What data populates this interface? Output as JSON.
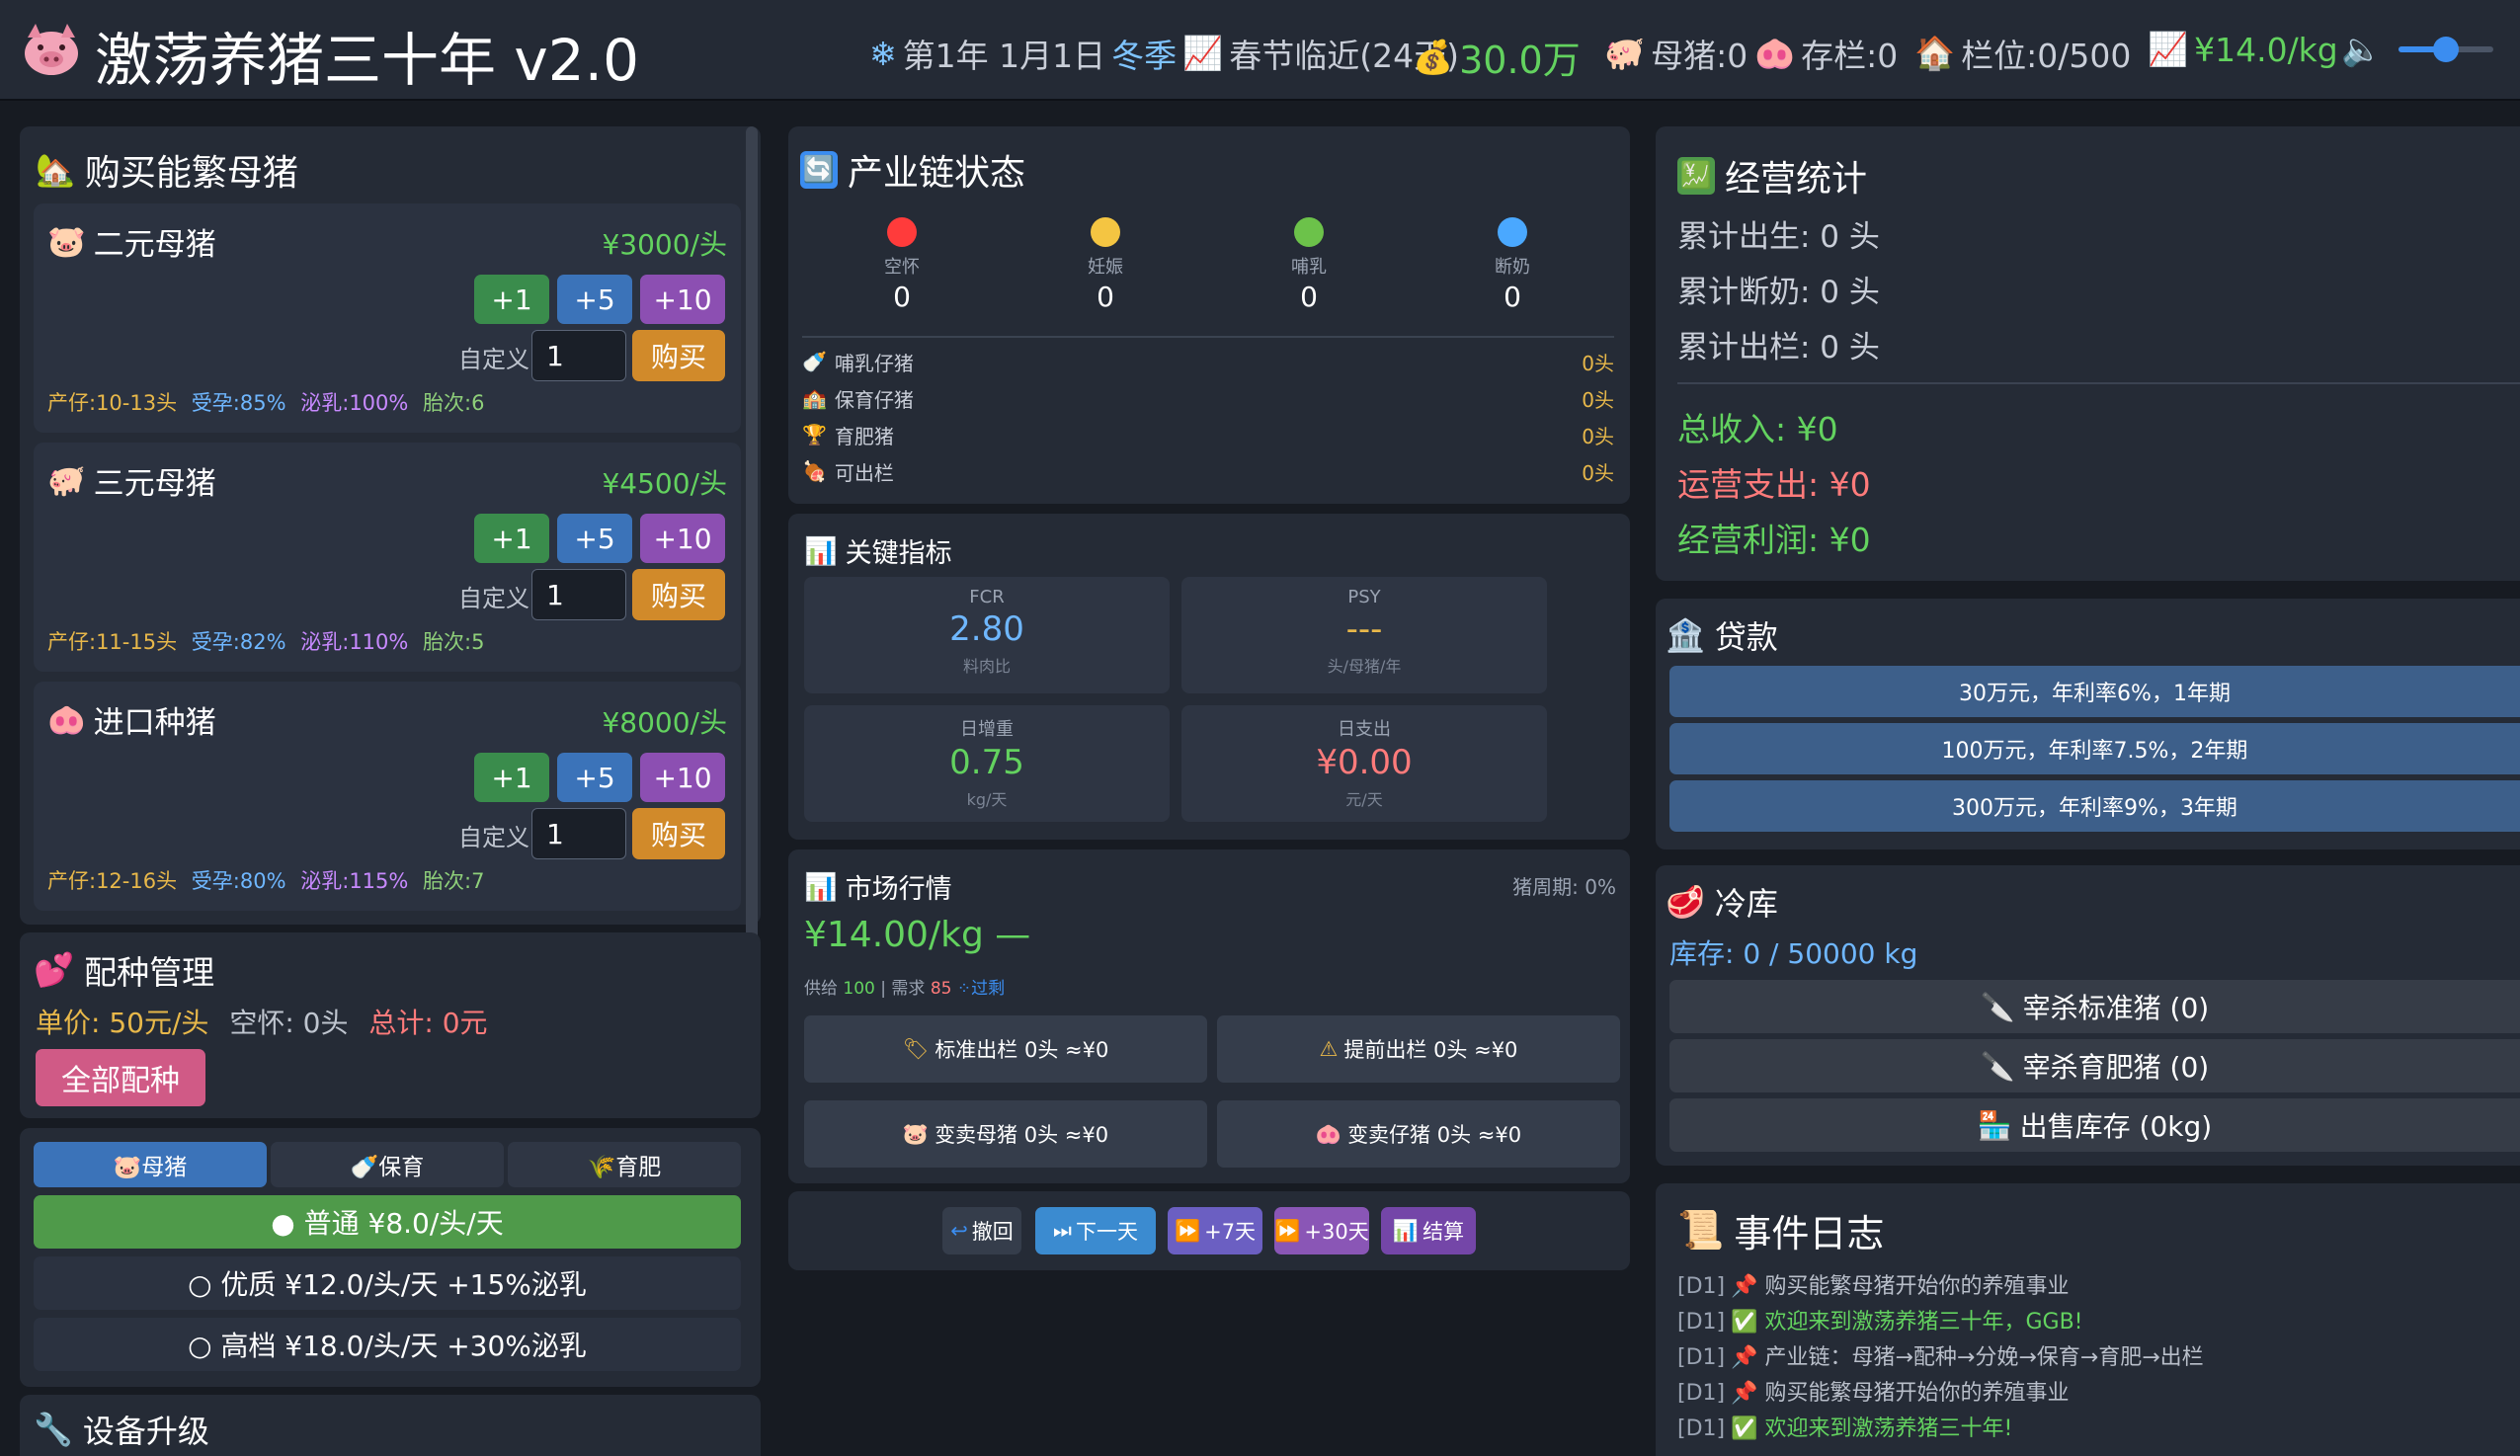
{
  "header": {
    "title": "激荡养猪三十年 v2.0",
    "date": "第1年 1月1日",
    "season": "冬季",
    "festival": "春节临近(24天)",
    "money": "30.0万",
    "sows": "母猪:0",
    "stock": "存栏:0",
    "pens": "栏位:0/500",
    "price": "¥14.0/kg",
    "volume_level": 0.5
  },
  "colors": {
    "accent_green": "#63d25f",
    "price_yellow": "#e8b84a",
    "bg": "#171b22",
    "panel": "#252b36"
  },
  "buy": {
    "title": "购买能繁母猪",
    "custom_label": "自定义:",
    "buy_label": "购买",
    "btn1": "+1",
    "btn5": "+5",
    "btn10": "+10",
    "items": [
      {
        "name": "二元母猪",
        "price": "¥3000/头",
        "input": "1",
        "litter": "产仔:10-13头",
        "conc": "受孕:85%",
        "milk": "泌乳:100%",
        "parity": "胎次:6"
      },
      {
        "name": "三元母猪",
        "price": "¥4500/头",
        "input": "1",
        "litter": "产仔:11-15头",
        "conc": "受孕:82%",
        "milk": "泌乳:110%",
        "parity": "胎次:5"
      },
      {
        "name": "进口种猪",
        "price": "¥8000/头",
        "input": "1",
        "litter": "产仔:12-16头",
        "conc": "受孕:80%",
        "milk": "泌乳:115%",
        "parity": "胎次:7"
      }
    ]
  },
  "breeding": {
    "title": "配种管理",
    "unit_price": "单价: 50元/头",
    "empty": "空怀: 0头",
    "total": "总计: 0元",
    "all_btn": "全部配种"
  },
  "feed": {
    "tabs": [
      "🐷母猪",
      "🍼保育",
      "🌾育肥"
    ],
    "options": [
      "● 普通 ¥8.0/头/天",
      "○ 优质 ¥12.0/头/天 +15%泌乳",
      "○ 高档 ¥18.0/头/天 +30%泌乳"
    ]
  },
  "equip": {
    "title": "设备升级"
  },
  "chain": {
    "title": "产业链状态",
    "stages": [
      {
        "label": "空怀",
        "value": "0"
      },
      {
        "label": "妊娠",
        "value": "0"
      },
      {
        "label": "哺乳",
        "value": "0"
      },
      {
        "label": "断奶",
        "value": "0"
      }
    ],
    "rows": [
      {
        "label": "哺乳仔猪",
        "value": "0头"
      },
      {
        "label": "保育仔猪",
        "value": "0头"
      },
      {
        "label": "育肥猪",
        "value": "0头"
      },
      {
        "label": "可出栏",
        "value": "0头"
      }
    ]
  },
  "kpi": {
    "title": "关键指标",
    "items": [
      {
        "top": "FCR",
        "value": "2.80",
        "sub": "料肉比"
      },
      {
        "top": "PSY",
        "value": "---",
        "sub": "头/母猪/年"
      },
      {
        "top": "日增重",
        "value": "0.75",
        "sub": "kg/天"
      },
      {
        "top": "日支出",
        "value": "¥0.00",
        "sub": "元/天"
      }
    ]
  },
  "market": {
    "title": "市场行情",
    "cycle": "猪周期: 0%",
    "price": "¥14.00/kg —",
    "supply_label": "供给",
    "supply": "100",
    "demand_label": "| 需求",
    "demand": "85",
    "status": "⁘过剩",
    "buttons": [
      "标准出栏 0头 ≈¥0",
      "提前出栏 0头 ≈¥0",
      "变卖母猪 0头 ≈¥0",
      "变卖仔猪 0头 ≈¥0"
    ]
  },
  "controls": {
    "undo": "撤回",
    "next": "下一天",
    "plus7": "+7天",
    "plus30": "+30天",
    "settle": "结算"
  },
  "stats": {
    "title": "经营统计",
    "born": "累计出生: 0 头",
    "weaned": "累计断奶: 0 头",
    "sold": "累计出栏: 0 头",
    "income": "总收入: ¥0",
    "expense": "运营支出: ¥0",
    "profit": "经营利润: ¥0"
  },
  "loan": {
    "title": "贷款",
    "options": [
      "30万元，年利率6%，1年期",
      "100万元，年利率7.5%，2年期",
      "300万元，年利率9%，3年期"
    ]
  },
  "cold": {
    "title": "冷库",
    "stock": "库存: 0 / 50000 kg",
    "slaughter_std": "宰杀标准猪 (0)",
    "slaughter_fat": "宰杀育肥猪 (0)",
    "sell": "出售库存 (0kg)"
  },
  "log": {
    "title": "事件日志",
    "entries": [
      {
        "day": "[D1]",
        "text": "📌 购买能繁母猪开始你的养殖事业",
        "color": "#b9bfca"
      },
      {
        "day": "[D1]",
        "text": "✅ 欢迎来到激荡养猪三十年，GGB!",
        "color": "#63d25f"
      },
      {
        "day": "[D1]",
        "text": "📌 产业链：母猪→配种→分娩→保育→育肥→出栏",
        "color": "#b9bfca"
      },
      {
        "day": "[D1]",
        "text": "📌 购买能繁母猪开始你的养殖事业",
        "color": "#b9bfca"
      },
      {
        "day": "[D1]",
        "text": "✅ 欢迎来到激荡养猪三十年!",
        "color": "#63d25f"
      }
    ]
  }
}
